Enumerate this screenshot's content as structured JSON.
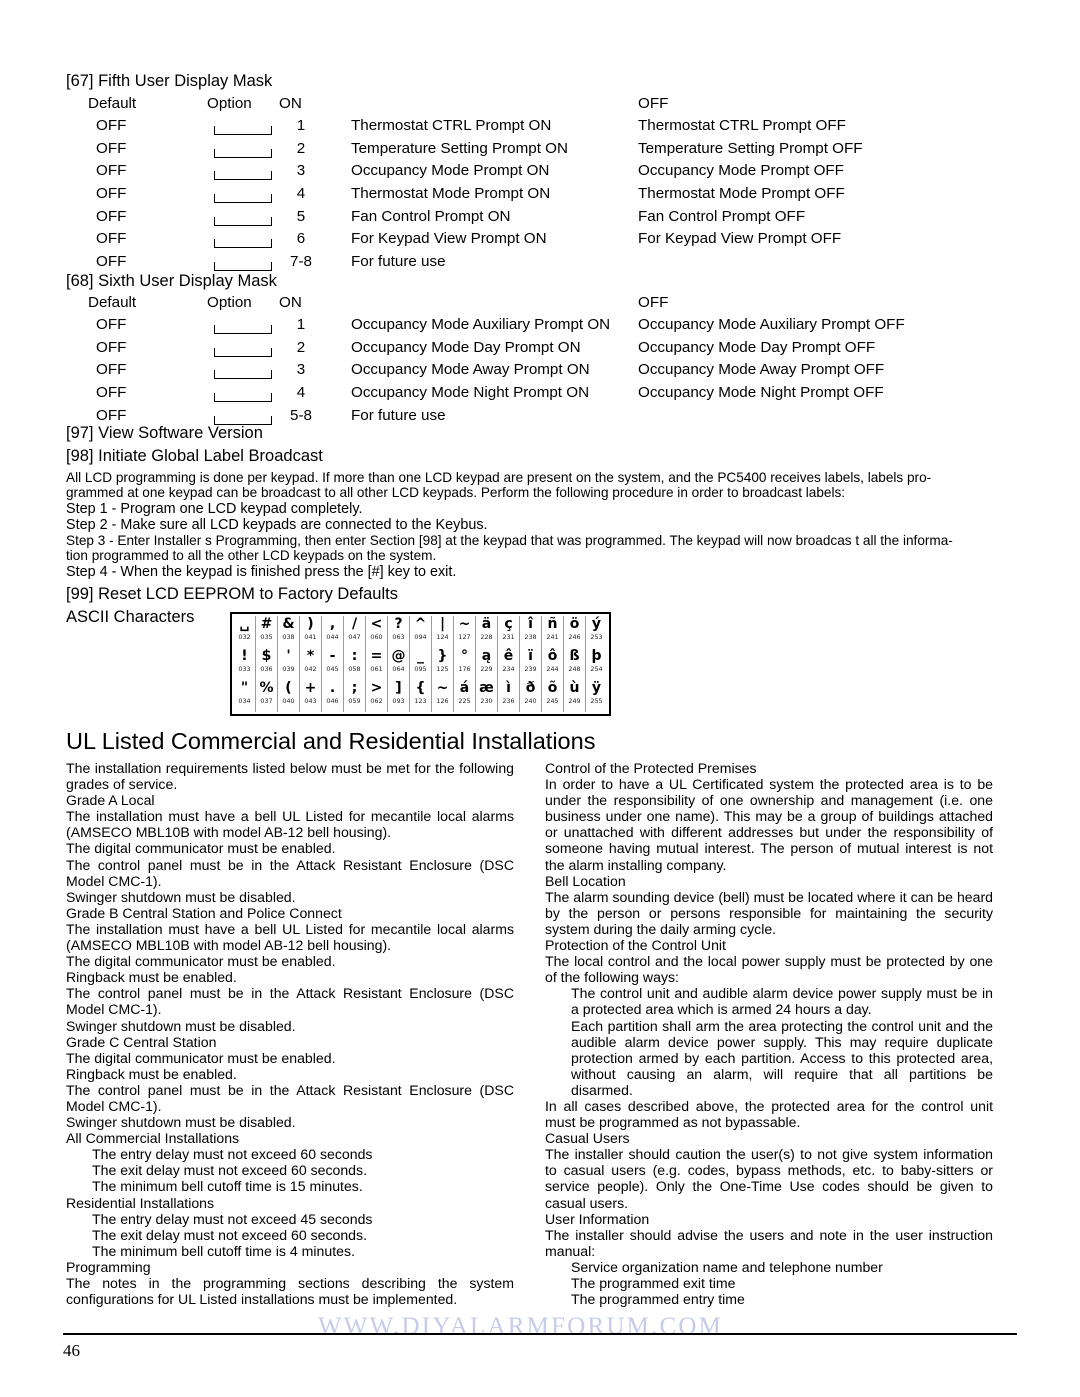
{
  "sections": {
    "s67": {
      "title": "[67] Fifth User Display Mask",
      "headers": {
        "default": "Default",
        "option": "Option",
        "on": "ON",
        "off": "OFF"
      },
      "rows": [
        {
          "default": "OFF",
          "option": "1",
          "on": "Thermostat CTRL Prompt ON",
          "off": "Thermostat CTRL Prompt OFF"
        },
        {
          "default": "OFF",
          "option": "2",
          "on": "Temperature Setting Prompt ON",
          "off": "Temperature Setting Prompt OFF"
        },
        {
          "default": "OFF",
          "option": "3",
          "on": "Occupancy Mode Prompt ON",
          "off": "Occupancy Mode Prompt OFF"
        },
        {
          "default": "OFF",
          "option": "4",
          "on": "Thermostat Mode Prompt ON",
          "off": "Thermostat Mode Prompt OFF"
        },
        {
          "default": "OFF",
          "option": "5",
          "on": "Fan Control Prompt ON",
          "off": "Fan Control Prompt OFF"
        },
        {
          "default": "OFF",
          "option": "6",
          "on": "For Keypad View Prompt ON",
          "off": "For Keypad View Prompt OFF"
        },
        {
          "default": "OFF",
          "option": "7-8",
          "on": "For future use",
          "off": ""
        }
      ]
    },
    "s68": {
      "title": "[68] Sixth User Display Mask",
      "headers": {
        "default": "Default",
        "option": "Option",
        "on": "ON",
        "off": "OFF"
      },
      "rows": [
        {
          "default": "OFF",
          "option": "1",
          "on": "Occupancy Mode Auxiliary Prompt ON",
          "off": "Occupancy Mode Auxiliary Prompt OFF"
        },
        {
          "default": "OFF",
          "option": "2",
          "on": "Occupancy Mode Day Prompt ON",
          "off": "Occupancy Mode Day Prompt OFF"
        },
        {
          "default": "OFF",
          "option": "3",
          "on": "Occupancy Mode Away Prompt ON",
          "off": "Occupancy Mode Away Prompt OFF"
        },
        {
          "default": "OFF",
          "option": "4",
          "on": "Occupancy Mode Night Prompt ON",
          "off": "Occupancy Mode Night Prompt OFF"
        },
        {
          "default": "OFF",
          "option": "5-8",
          "on": "For future use",
          "off": ""
        }
      ]
    },
    "s97": {
      "title": "[97] View Software Version"
    },
    "s98": {
      "title": "[98] Initiate Global Label Broadcast",
      "intro_line1": "All LCD programming is done per keypad. If more than one LCD keypad are present on the system, and the PC5400 receives labels,   labels pro-",
      "intro_line2": "grammed at one keypad can be broadcast to all other LCD keypads. Perform the following procedure in order to broadcast labels:",
      "step1": "Step 1 - Program one LCD keypad completely.",
      "step2": "Step 2 - Make sure all LCD keypads are connected to the Keybus.",
      "step3_line1": "Step 3 - Enter Installer s Programming, then enter Section [98] at the keypad that was programmed. The keypad will now broadcas  t all the informa-",
      "step3_line2": "tion programmed to all the other LCD keypads on the system.",
      "step4": "Step 4 - When the keypad is finished press the [#] key to exit."
    },
    "s99": {
      "title": "[99] Reset LCD EEPROM to Factory Defaults"
    },
    "ascii": {
      "label": "ASCII Characters"
    }
  },
  "ascii_table": {
    "rows": [
      [
        {
          "glyph": "␣",
          "code": "032"
        },
        {
          "glyph": "#",
          "code": "035"
        },
        {
          "glyph": "&",
          "code": "038"
        },
        {
          "glyph": ")",
          "code": "041"
        },
        {
          "glyph": ",",
          "code": "044"
        },
        {
          "glyph": "/",
          "code": "047"
        },
        {
          "glyph": "<",
          "code": "060"
        },
        {
          "glyph": "?",
          "code": "063"
        },
        {
          "glyph": "^",
          "code": "094"
        },
        {
          "glyph": "|",
          "code": "124"
        },
        {
          "glyph": "~",
          "code": "127"
        },
        {
          "glyph": "ä",
          "code": "228"
        },
        {
          "glyph": "ç",
          "code": "231"
        },
        {
          "glyph": "î",
          "code": "238"
        },
        {
          "glyph": "ñ",
          "code": "241"
        },
        {
          "glyph": "ö",
          "code": "246"
        },
        {
          "glyph": "ý",
          "code": "253"
        }
      ],
      [
        {
          "glyph": "!",
          "code": "033"
        },
        {
          "glyph": "$",
          "code": "036"
        },
        {
          "glyph": "'",
          "code": "039"
        },
        {
          "glyph": "*",
          "code": "042"
        },
        {
          "glyph": "-",
          "code": "045"
        },
        {
          "glyph": ":",
          "code": "058"
        },
        {
          "glyph": "=",
          "code": "061"
        },
        {
          "glyph": "@",
          "code": "064"
        },
        {
          "glyph": "_",
          "code": "095"
        },
        {
          "glyph": "}",
          "code": "125"
        },
        {
          "glyph": "°",
          "code": "176"
        },
        {
          "glyph": "ą",
          "code": "229"
        },
        {
          "glyph": "ê",
          "code": "234"
        },
        {
          "glyph": "ï",
          "code": "239"
        },
        {
          "glyph": "ô",
          "code": "244"
        },
        {
          "glyph": "ß",
          "code": "248"
        },
        {
          "glyph": "þ",
          "code": "254"
        }
      ],
      [
        {
          "glyph": "\"",
          "code": "034"
        },
        {
          "glyph": "%",
          "code": "037"
        },
        {
          "glyph": "(",
          "code": "040"
        },
        {
          "glyph": "+",
          "code": "043"
        },
        {
          "glyph": ".",
          "code": "046"
        },
        {
          "glyph": ";",
          "code": "059"
        },
        {
          "glyph": ">",
          "code": "062"
        },
        {
          "glyph": "]",
          "code": "093"
        },
        {
          "glyph": "{",
          "code": "123"
        },
        {
          "glyph": "~",
          "code": "126"
        },
        {
          "glyph": "á",
          "code": "225"
        },
        {
          "glyph": "æ",
          "code": "230"
        },
        {
          "glyph": "ì",
          "code": "236"
        },
        {
          "glyph": "ð",
          "code": "240"
        },
        {
          "glyph": "õ",
          "code": "245"
        },
        {
          "glyph": "ù",
          "code": "249"
        },
        {
          "glyph": "ÿ",
          "code": "255"
        }
      ]
    ]
  },
  "ul": {
    "heading": "UL Listed Commercial and Residential Installations",
    "left": {
      "intro": "The installation requirements listed below must be met for the following grades of service.",
      "gradeA_head": "Grade A Local",
      "gradeA_l1": "The installation must have a bell UL Listed for mecantile local alarms (AMSECO MBL10B with model AB-12 bell housing).",
      "gradeA_l2": "The digital communicator must be enabled.",
      "gradeA_l3": "The control panel must be in the Attack Resistant Enclosure (DSC Model CMC-1).",
      "gradeA_l4": "Swinger shutdown must be disabled.",
      "gradeB_head": "Grade B Central Station and Police Connect",
      "gradeB_l1": "The installation must have a bell UL Listed for mecantile local alarms (AMSECO MBL10B with model AB-12 bell housing).",
      "gradeB_l2": "The digital communicator must be enabled.",
      "gradeB_l3": "Ringback must be enabled.",
      "gradeB_l4": "The control panel must be in the Attack Resistant Enclosure (DSC Model CMC-1).",
      "gradeB_l5": "Swinger shutdown must be disabled.",
      "gradeC_head": "Grade C Central Station",
      "gradeC_l1": "The digital communicator must be enabled.",
      "gradeC_l2": "Ringback must be enabled.",
      "gradeC_l3": "The control panel must be in the Attack Resistant Enclosure (DSC Model CMC-1).",
      "gradeC_l4": "Swinger shutdown must be disabled.",
      "commercial_head": "All Commercial Installations",
      "commercial_l1": "The entry delay must not exceed 60 seconds",
      "commercial_l2": "The exit delay must not exceed 60 seconds.",
      "commercial_l3": "The minimum bell cutoff time is 15 minutes.",
      "residential_head": "Residential Installations",
      "residential_l1": "The entry delay must not exceed 45 seconds",
      "residential_l2": "The exit delay must not exceed 60 seconds.",
      "residential_l3": "The minimum bell cutoff time is 4 minutes.",
      "programming_head": "Programming",
      "programming_l1": "The notes in the programming sections describing the system configurations for UL Listed installations must be implemented."
    },
    "right": {
      "control_head": "Control of the Protected Premises",
      "control_p": "In order to have a UL Certificated system the protected area is to be under the responsibility of one ownership and management (i.e. one business under one name). This may be a group of buildings attached or unattached with different addresses but under the responsibility of someone having mutual interest. The person of mutual interest is not the alarm installing company.",
      "bell_head": "Bell Location",
      "bell_p": "The alarm sounding device (bell) must be located where it can be heard by the person or persons responsible for maintaining the security system during the daily arming cycle.",
      "protection_head": "Protection of the Control Unit",
      "protection_p": "The local control and the local power supply must be protected by one of the following ways:",
      "protection_i1": "The control unit and audible alarm device power supply must be in a protected area which is armed 24 hours a day.",
      "protection_i2": "Each partition shall arm the area protecting the control unit and the audible alarm device power supply. This may require duplicate protection armed by each partition. Access to this protected area, without causing an alarm, will require that all partitions be disarmed.",
      "protection_p2": "In all cases described above, the protected area for the control unit must be programmed as not bypassable.",
      "casual_head": "Casual Users",
      "casual_p": "The installer should caution the user(s) to not give system information to casual users (e.g. codes, bypass methods, etc. to baby-sitters or service people). Only the One-Time Use codes should be given to casual users.",
      "userinfo_head": "User Information",
      "userinfo_p": "The installer should advise the users and note in the user instruction manual:",
      "userinfo_i1": "Service organization name and telephone number",
      "userinfo_i2": "The programmed exit time",
      "userinfo_i3": "The programmed entry time"
    }
  },
  "footer": {
    "page_number": "46",
    "watermark": "WWW.DIYALARMFORUM.COM"
  }
}
